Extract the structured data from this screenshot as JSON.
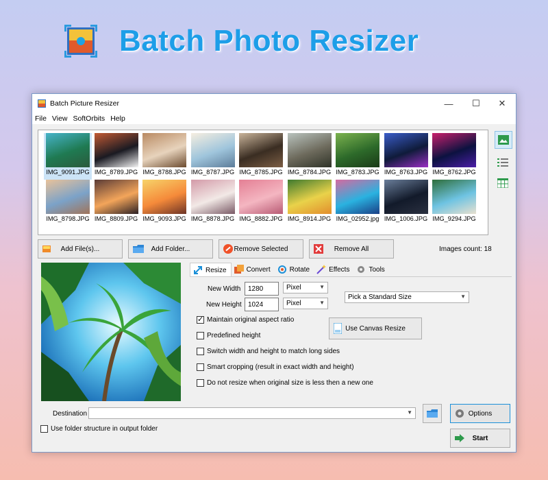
{
  "header": {
    "title": "Batch Photo Resizer",
    "logo_icon": "app-logo-icon"
  },
  "window": {
    "title": "Batch Picture Resizer",
    "controls": {
      "minimize": "—",
      "maximize": "☐",
      "close": "✕"
    },
    "menu": [
      "File",
      "View",
      "SoftOrbits",
      "Help"
    ],
    "gallery": [
      {
        "name": "IMG_9091.JPG",
        "colors": [
          "#1f7a52",
          "#46b3c9",
          "#2b5a3c"
        ],
        "selected": true
      },
      {
        "name": "IMG_8789.JPG",
        "colors": [
          "#1a1a22",
          "#c25a34",
          "#f4f4f4"
        ]
      },
      {
        "name": "IMG_8788.JPG",
        "colors": [
          "#e7d3bc",
          "#b98a62",
          "#6c4b2f"
        ]
      },
      {
        "name": "IMG_8787.JPG",
        "colors": [
          "#9fc5dc",
          "#f6eee0",
          "#5d7d9a"
        ]
      },
      {
        "name": "IMG_8785.JPG",
        "colors": [
          "#3a2d22",
          "#c9b49a",
          "#7c5e44"
        ]
      },
      {
        "name": "IMG_8784.JPG",
        "colors": [
          "#6d6a5c",
          "#b9c3be",
          "#2f3328"
        ]
      },
      {
        "name": "IMG_8783.JPG",
        "colors": [
          "#2d6a2a",
          "#7cb24e",
          "#1a3b17"
        ]
      },
      {
        "name": "IMG_8763.JPG",
        "colors": [
          "#0f1b3a",
          "#3a5dc9",
          "#9a2ec4"
        ]
      },
      {
        "name": "IMG_8762.JPG",
        "colors": [
          "#0c1240",
          "#c8206c",
          "#4c1ea8"
        ]
      },
      {
        "name": "IMG_8798.JPG",
        "colors": [
          "#7ba2c8",
          "#e9c29a",
          "#a0745a"
        ]
      },
      {
        "name": "IMG_8809.JPG",
        "colors": [
          "#f3a55a",
          "#5a3b36",
          "#2b2024"
        ]
      },
      {
        "name": "IMG_9093.JPG",
        "colors": [
          "#f58a3a",
          "#f7d36a",
          "#6d3426"
        ]
      },
      {
        "name": "IMG_8878.JPG",
        "colors": [
          "#f2e9e6",
          "#d39aa8",
          "#7a5a66"
        ]
      },
      {
        "name": "IMG_8882.JPG",
        "colors": [
          "#f4b6c1",
          "#e47f94",
          "#b85a74"
        ]
      },
      {
        "name": "IMG_8914.JPG",
        "colors": [
          "#e9d24a",
          "#3e7a2e",
          "#e28d2d"
        ]
      },
      {
        "name": "IMG_02952.jpg",
        "colors": [
          "#2ab2e0",
          "#d66aa0",
          "#1a3f86"
        ]
      },
      {
        "name": "IMG_1006.JPG",
        "colors": [
          "#121a2a",
          "#6a7e9a",
          "#2a3040"
        ]
      },
      {
        "name": "IMG_9294.JPG",
        "colors": [
          "#6ec3e2",
          "#2e6e3a",
          "#e8e0cf"
        ]
      }
    ],
    "side_icons": [
      "thumbnail-view-icon",
      "list-view-icon",
      "table-view-icon"
    ],
    "buttons": {
      "add_files": "Add File(s)...",
      "add_folder": "Add Folder...",
      "remove_selected": "Remove Selected",
      "remove_all": "Remove All"
    },
    "images_count": "Images count: 18",
    "tabs": [
      {
        "label": "Resize",
        "active": true
      },
      {
        "label": "Convert"
      },
      {
        "label": "Rotate"
      },
      {
        "label": "Effects"
      },
      {
        "label": "Tools"
      }
    ],
    "resize": {
      "width_label": "New Width",
      "width_value": "1280",
      "width_unit": "Pixel",
      "height_label": "New Height",
      "height_value": "1024",
      "height_unit": "Pixel",
      "standard_size": "Pick a Standard Size",
      "canvas_button": "Use Canvas Resize",
      "options": [
        {
          "label": "Maintain original aspect ratio",
          "checked": true
        },
        {
          "label": "Predefined height",
          "checked": false
        },
        {
          "label": "Switch width and height to match long sides",
          "checked": false
        },
        {
          "label": "Smart cropping (result in exact width and height)",
          "checked": false
        },
        {
          "label": "Do not resize when original size is less then a new one",
          "checked": false
        }
      ]
    },
    "destination_label": "Destination",
    "destination_value": "",
    "folder_structure_label": "Use folder structure in output folder",
    "folder_structure_checked": false,
    "options_button": "Options",
    "start_button": "Start"
  }
}
